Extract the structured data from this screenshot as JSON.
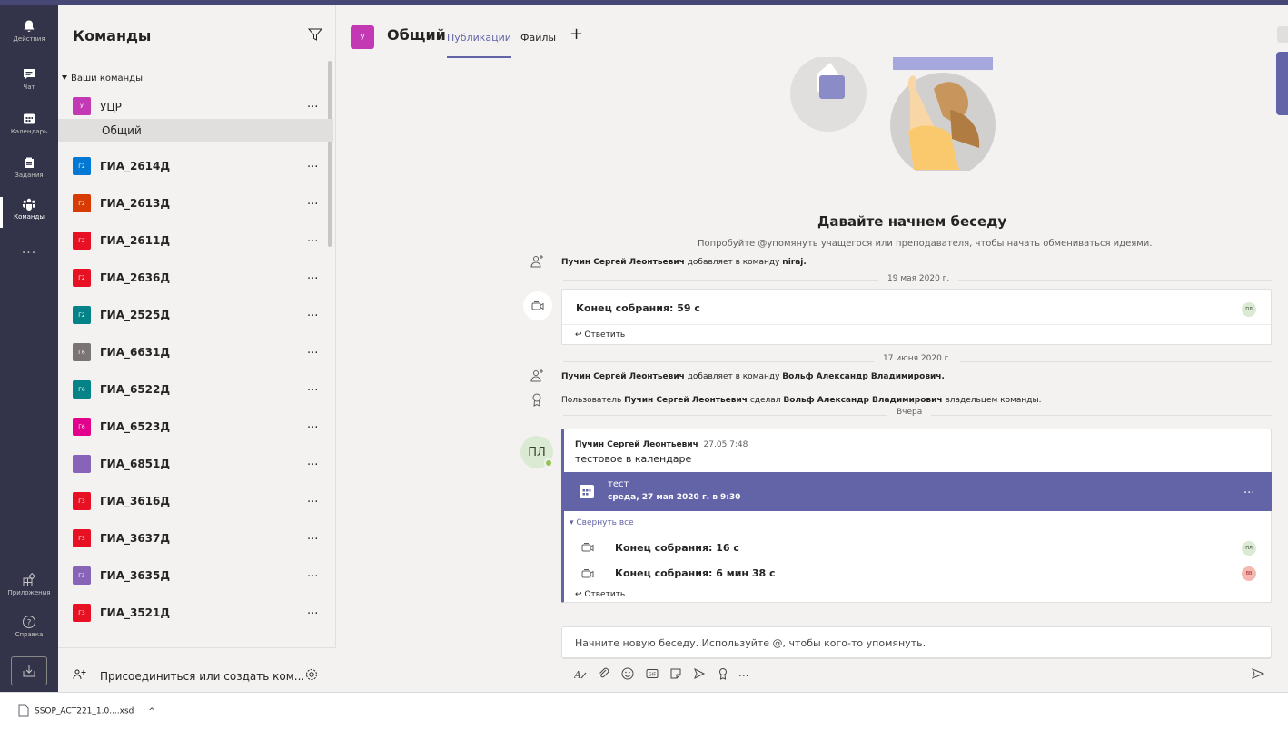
{
  "rail": {
    "items": [
      {
        "label": "Действия",
        "icon": "bell-icon"
      },
      {
        "label": "Чат",
        "icon": "chat-icon"
      },
      {
        "label": "Календарь",
        "icon": "calendar-icon"
      },
      {
        "label": "Задания",
        "icon": "assignments-icon"
      },
      {
        "label": "Команды",
        "icon": "teams-icon",
        "active": true
      }
    ],
    "more": "...",
    "apps_label": "Приложения",
    "help_label": "Справка"
  },
  "teams": {
    "title": "Команды",
    "section": "Ваши команды",
    "first_team": {
      "avatar": "У",
      "name": "УЦР",
      "color": "#c239b3"
    },
    "channel": "Общий",
    "list": [
      {
        "avatar": "Г2",
        "name": "ГИА_2614Д",
        "color": "#0078d4"
      },
      {
        "avatar": "Г2",
        "name": "ГИА_2613Д",
        "color": "#d83b01"
      },
      {
        "avatar": "Г2",
        "name": "ГИА_2611Д",
        "color": "#e81123"
      },
      {
        "avatar": "Г2",
        "name": "ГИА_2636Д",
        "color": "#e81123"
      },
      {
        "avatar": "Г2",
        "name": "ГИА_2525Д",
        "color": "#038387"
      },
      {
        "avatar": "Г6",
        "name": "ГИА_6631Д",
        "color": "#7a7574"
      },
      {
        "avatar": "Г6",
        "name": "ГИА_6522Д",
        "color": "#038387"
      },
      {
        "avatar": "Г6",
        "name": "ГИА_6523Д",
        "color": "#e3008c"
      },
      {
        "avatar": "",
        "name": "ГИА_6851Д",
        "color": "#8764b8"
      },
      {
        "avatar": "Г3",
        "name": "ГИА_3616Д",
        "color": "#e81123"
      },
      {
        "avatar": "Г3",
        "name": "ГИА_3637Д",
        "color": "#e81123"
      },
      {
        "avatar": "Г3",
        "name": "ГИА_3635Д",
        "color": "#8764b8"
      },
      {
        "avatar": "Г3",
        "name": "ГИА_3521Д",
        "color": "#e81123"
      }
    ],
    "more": "...",
    "join_label": "Присоединиться или создать ком..."
  },
  "channel": {
    "avatar": "У",
    "title": "Общий",
    "tabs": [
      "Публикации",
      "Файлы"
    ],
    "add_tab": "+"
  },
  "welcome": {
    "title": "Давайте начнем беседу",
    "subtitle": "Попробуйте @упомянуть учащегося или преподавателя, чтобы начать обмениваться идеями."
  },
  "feed": {
    "sys1": {
      "actor": "Пучин Сергей Леонтьевич",
      "action": " добавляет в команду ",
      "target": "niraj."
    },
    "date1": "19 мая 2020 г.",
    "meeting1": {
      "title": "Конец собрания: 59 с",
      "avatar": "ПЛ",
      "reply": "Ответить"
    },
    "date2": "17 июня 2020 г.",
    "sys2": {
      "actor": "Пучин Сергей Леонтьевич",
      "action": " добавляет в команду ",
      "target": "Вольф Александр Владимирович."
    },
    "sys3": {
      "prefix": "Пользователь ",
      "actor": "Пучин Сергей Леонтьевич",
      "action": " сделал ",
      "target": "Вольф Александр Владимирович",
      "suffix": " владельцем команды."
    },
    "date3": "Вчера",
    "post": {
      "avatar": "ПЛ",
      "author": "Пучин Сергей Леонтьевич",
      "time": "27.05 7:48",
      "text": "тестовое в календаре",
      "event_title": "тест",
      "event_date": "среда, 27 мая 2020 г. в 9:30",
      "event_more": "...",
      "collapse": "Свернуть все",
      "replies": [
        {
          "title": "Конец собрания: 16 с",
          "avatar": "ПЛ"
        },
        {
          "title": "Конец собрания: 6 мин 38 с",
          "avatar": "ВВ"
        }
      ],
      "reply": "Ответить"
    }
  },
  "compose": {
    "placeholder": "Начните новую беседу. Используйте @, чтобы кого-то упомянуть.",
    "more": "..."
  },
  "download": {
    "file": "SSOP_ACT221_1.0....xsd"
  }
}
